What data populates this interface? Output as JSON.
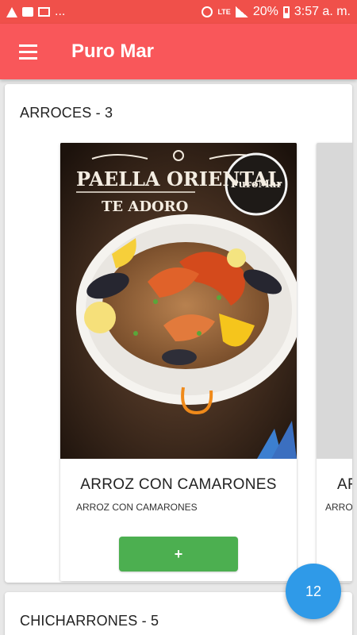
{
  "status_bar": {
    "left_overflow": "...",
    "lte": "LTE",
    "battery": "20%",
    "time": "3:57 a. m.",
    "icons": [
      "warning-icon",
      "message-icon",
      "mail-icon",
      "alarm-icon",
      "signal-icon",
      "battery-icon"
    ]
  },
  "app_bar": {
    "title": "Puro Mar",
    "menu_icon": "hamburger-menu-icon"
  },
  "sections": [
    {
      "title": "ARROCES - 3",
      "items": [
        {
          "name": "ARROZ CON CAMARONES",
          "description": "ARROZ CON CAMARONES",
          "image_text": {
            "title": "PAELLA ORIENTAL",
            "subtitle": "TE ADORO",
            "logo": "PuroMar"
          },
          "add_label": "+"
        },
        {
          "name": "AR",
          "description": "ARROZ",
          "add_label": "+"
        }
      ]
    },
    {
      "title": "CHICHARRONES - 5"
    }
  ],
  "cart": {
    "count": "12"
  },
  "colors": {
    "primary": "#f9575a",
    "status_bar": "#f0504a",
    "add_button": "#4caf50",
    "fab": "#2f9ae8"
  }
}
